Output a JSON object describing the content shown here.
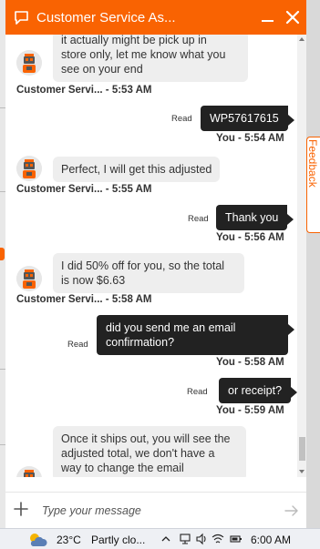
{
  "header": {
    "title": "Customer Service As..."
  },
  "messages": [
    {
      "from": "agent",
      "text_lines": [
        "it actually might be pick up in",
        "store only, let me know what you",
        "see on your end"
      ],
      "sender": "Customer Servi...",
      "time": "- 5:53 AM"
    },
    {
      "from": "user",
      "text": "WP57617615",
      "read": "Read",
      "meta": "You - 5:54 AM"
    },
    {
      "from": "agent",
      "text_lines": [
        "Perfect, I will get this adjusted"
      ],
      "sender": "Customer Servi...",
      "time": "- 5:55 AM"
    },
    {
      "from": "user",
      "text": "Thank you",
      "read": "Read",
      "meta": "You - 5:56 AM"
    },
    {
      "from": "agent",
      "text_lines": [
        "I did 50% off for you, so the total",
        "is now $6.63"
      ],
      "sender": "Customer Servi...",
      "time": "- 5:58 AM"
    },
    {
      "from": "user",
      "text_lines": [
        "did you send me an email",
        "confirmation?"
      ],
      "read": "Read",
      "meta": "You - 5:58 AM"
    },
    {
      "from": "user",
      "text": "or receipt?",
      "read": "Read",
      "meta": "You - 5:59 AM"
    },
    {
      "from": "agent",
      "text_lines": [
        "Once it ships out, you will see the",
        "adjusted total, we don't have a",
        "way to change the email"
      ]
    }
  ],
  "composer": {
    "placeholder": "Type your message"
  },
  "feedback": {
    "label": "Feedback"
  },
  "taskbar": {
    "temperature": "23°C",
    "condition": "Partly clo...",
    "time": "6:00 AM"
  },
  "colors": {
    "brand": "#f96302",
    "user_bubble": "#222222",
    "agent_bubble": "#eeeeee"
  }
}
